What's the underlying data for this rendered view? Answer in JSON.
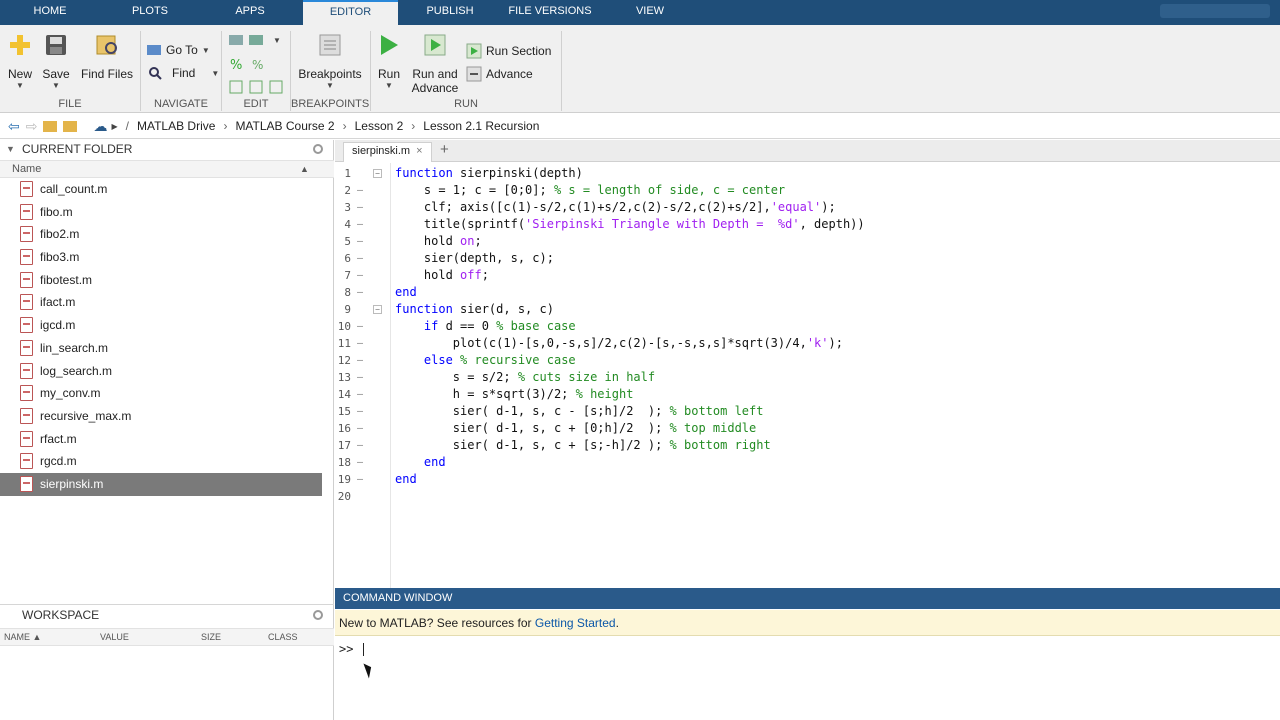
{
  "top_tabs": [
    {
      "label": "HOME"
    },
    {
      "label": "PLOTS"
    },
    {
      "label": "APPS"
    },
    {
      "label": "EDITOR"
    },
    {
      "label": "PUBLISH"
    },
    {
      "label": "FILE VERSIONS"
    },
    {
      "label": "VIEW"
    }
  ],
  "ribbon": {
    "new": "New",
    "save": "Save",
    "find_files": "Find Files",
    "go_to": "Go To",
    "find": "Find",
    "breakpoints": "Breakpoints",
    "run": "Run",
    "run_and_advance_1": "Run and",
    "run_and_advance_2": "Advance",
    "run_section": "Run Section",
    "advance": "Advance",
    "groups": {
      "file": "FILE",
      "navigate": "NAVIGATE",
      "edit": "EDIT",
      "breakpoints": "BREAKPOINTS",
      "run": "RUN"
    }
  },
  "address": {
    "root": "/",
    "crumbs": [
      "MATLAB Drive",
      "MATLAB Course 2",
      "Lesson 2",
      "Lesson 2.1 Recursion"
    ]
  },
  "current_folder": {
    "title": "CURRENT FOLDER",
    "col_name": "Name",
    "files": [
      "call_count.m",
      "fibo.m",
      "fibo2.m",
      "fibo3.m",
      "fibotest.m",
      "ifact.m",
      "igcd.m",
      "lin_search.m",
      "log_search.m",
      "my_conv.m",
      "recursive_max.m",
      "rfact.m",
      "rgcd.m",
      "sierpinski.m"
    ],
    "selected_file": "sierpinski.m"
  },
  "workspace": {
    "title": "WORKSPACE",
    "cols": {
      "name": "NAME ▲",
      "value": "VALUE",
      "size": "SIZE",
      "class": "CLASS"
    }
  },
  "editor": {
    "tab_label": "sierpinski.m",
    "lines": [
      "function sierpinski(depth)",
      "    s = 1; c = [0;0]; % s = length of side, c = center",
      "    clf; axis([c(1)-s/2,c(1)+s/2,c(2)-s/2,c(2)+s/2],'equal');",
      "    title(sprintf('Sierpinski Triangle with Depth =  %d', depth))",
      "    hold on;",
      "    sier(depth, s, c);",
      "    hold off;",
      "end",
      "function sier(d, s, c)",
      "    if d == 0 % base case",
      "        plot(c(1)-[s,0,-s,s]/2,c(2)-[s,-s,s,s]*sqrt(3)/4,'k');",
      "    else % recursive case",
      "        s = s/2; % cuts size in half",
      "        h = s*sqrt(3)/2; % height",
      "        sier( d-1, s, c - [s;h]/2  ); % bottom left",
      "        sier( d-1, s, c + [0;h]/2  ); % top middle",
      "        sier( d-1, s, c + [s;-h]/2 ); % bottom right",
      "    end",
      "end",
      ""
    ]
  },
  "command_window": {
    "title": "COMMAND WINDOW",
    "banner_text": "New to MATLAB? See resources for ",
    "banner_link": "Getting Started",
    "banner_end": ".",
    "prompt": ">>"
  }
}
